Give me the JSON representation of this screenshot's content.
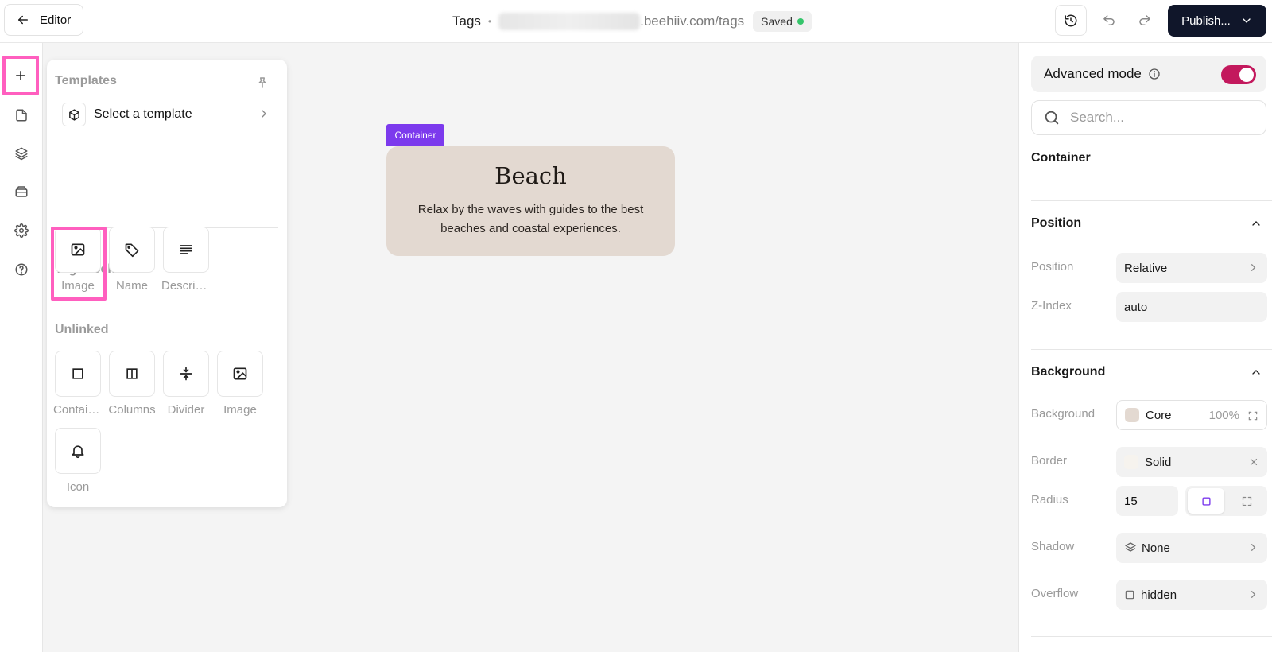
{
  "topbar": {
    "back_label": "Editor",
    "page_title": "Tags",
    "url_domain": ".beehiiv.com/tags",
    "saved_label": "Saved",
    "publish_label": "Publish..."
  },
  "insert_panel": {
    "templates_title": "Templates",
    "select_template_label": "Select a template",
    "tag_blocks_title": "Tag Blocks",
    "tag_blocks": [
      {
        "label": "Image",
        "icon": "image-icon"
      },
      {
        "label": "Name",
        "icon": "tag-icon"
      },
      {
        "label": "Description",
        "icon": "text-lines-icon"
      }
    ],
    "unlinked_title": "Unlinked",
    "unlinked_blocks": [
      {
        "label": "Container",
        "icon": "square-icon"
      },
      {
        "label": "Columns",
        "icon": "columns-icon"
      },
      {
        "label": "Divider",
        "icon": "divider-icon"
      },
      {
        "label": "Image",
        "icon": "image-icon"
      },
      {
        "label": "Icon",
        "icon": "bell-icon"
      }
    ]
  },
  "canvas": {
    "selection_tag": "Container",
    "card_title": "Beach",
    "card_description": "Relax by the waves with guides to the best beaches and coastal experiences.",
    "card_background": "#e3d9d1"
  },
  "properties": {
    "advanced_mode_label": "Advanced mode",
    "advanced_mode_on": true,
    "search_placeholder": "Search...",
    "element_type": "Container",
    "position_section": {
      "title": "Position",
      "position_label": "Position",
      "position_value": "Relative",
      "zindex_label": "Z-Index",
      "zindex_value": "auto"
    },
    "background_section": {
      "title": "Background",
      "background_label": "Background",
      "background_value": "Core",
      "background_opacity": "100%",
      "border_label": "Border",
      "border_value": "Solid",
      "radius_label": "Radius",
      "radius_value": "15",
      "shadow_label": "Shadow",
      "shadow_value": "None",
      "overflow_label": "Overflow",
      "overflow_value": "hidden"
    }
  },
  "colors": {
    "accent_purple": "#7c3aed",
    "toggle_on": "#c3195d",
    "publish_bg": "#10162a",
    "highlight_pink": "#ff5fbf",
    "saved_green": "#35c56b"
  }
}
